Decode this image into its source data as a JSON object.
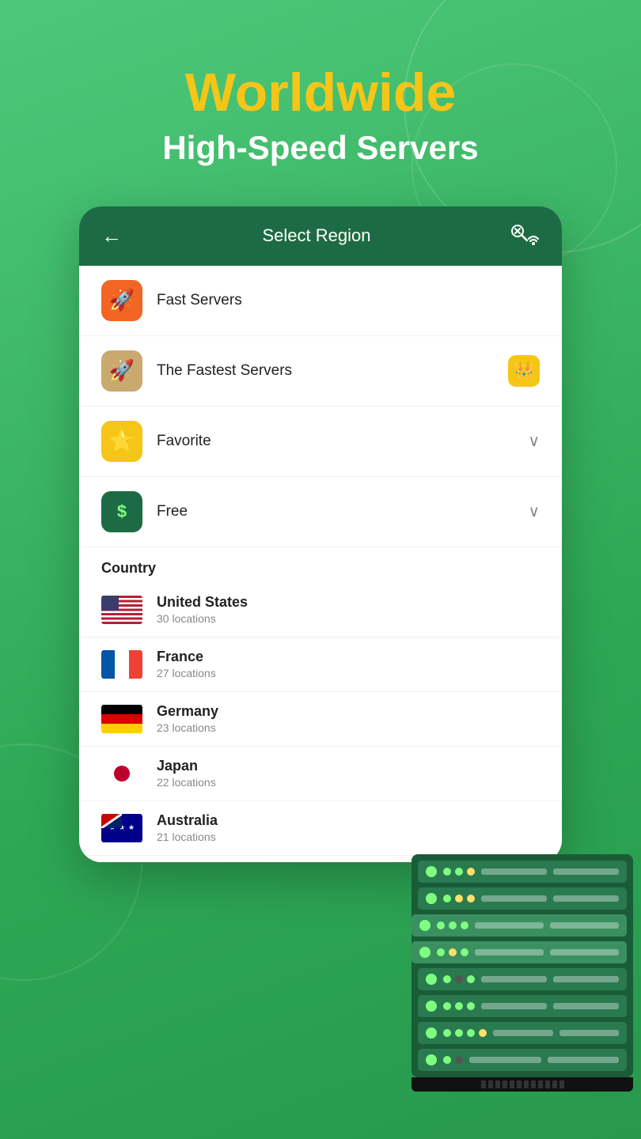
{
  "background": {
    "color": "#3cb96a"
  },
  "header": {
    "title_line1": "Worldwide",
    "title_line2": "High-Speed Servers"
  },
  "card": {
    "header": {
      "back_label": "←",
      "title": "Select Region",
      "icon_label": "⊗≈🔍"
    },
    "menu_items": [
      {
        "id": "fast-servers",
        "icon": "🚀",
        "icon_style": "orange",
        "label": "Fast Servers",
        "right": ""
      },
      {
        "id": "fastest-servers",
        "icon": "🚀",
        "icon_style": "tan",
        "label": "The Fastest Servers",
        "right": "crown"
      },
      {
        "id": "favorite",
        "icon": "⭐",
        "icon_style": "yellow",
        "label": "Favorite",
        "right": "chevron"
      },
      {
        "id": "free",
        "icon": "$",
        "icon_style": "green",
        "label": "Free",
        "right": "chevron"
      }
    ],
    "country_section": {
      "header": "Country",
      "countries": [
        {
          "id": "us",
          "name": "United States",
          "locations": "30 locations",
          "flag": "us"
        },
        {
          "id": "fr",
          "name": "France",
          "locations": "27 locations",
          "flag": "fr"
        },
        {
          "id": "de",
          "name": "Germany",
          "locations": "23 locations",
          "flag": "de"
        },
        {
          "id": "jp",
          "name": "Japan",
          "locations": "22 locations",
          "flag": "jp"
        },
        {
          "id": "au",
          "name": "Australia",
          "locations": "21 locations",
          "flag": "au"
        }
      ]
    }
  },
  "server_rack": {
    "rows": 8
  }
}
